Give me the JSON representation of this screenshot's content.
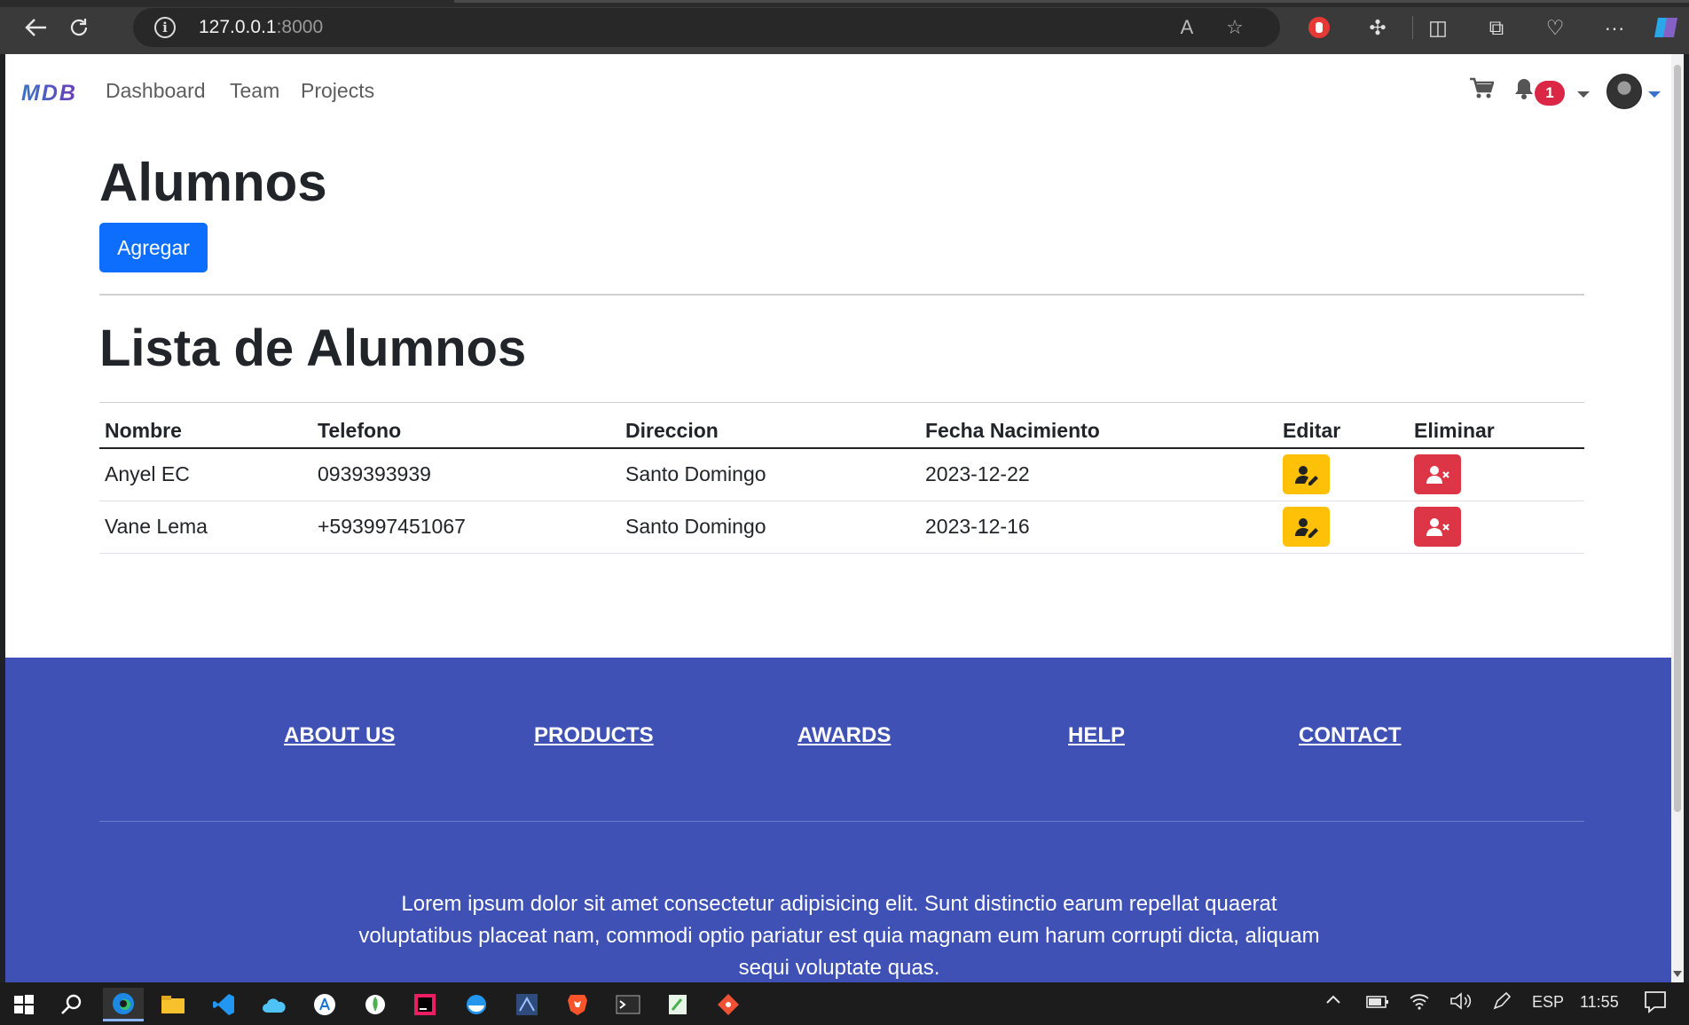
{
  "browser": {
    "url_host": "127.0.0.1",
    "url_port": ":8000"
  },
  "navbar": {
    "brand": "MDB",
    "links": [
      "Dashboard",
      "Team",
      "Projects"
    ],
    "notification_count": "1"
  },
  "main": {
    "title": "Alumnos",
    "add_label": "Agregar",
    "list_title": "Lista de Alumnos",
    "columns": [
      "Nombre",
      "Telefono",
      "Direccion",
      "Fecha Nacimiento",
      "Editar",
      "Eliminar"
    ],
    "rows": [
      {
        "nombre": "Anyel EC",
        "telefono": "0939393939",
        "direccion": "Santo Domingo",
        "fecha": "2023-12-22"
      },
      {
        "nombre": "Vane Lema",
        "telefono": "+593997451067",
        "direccion": "Santo Domingo",
        "fecha": "2023-12-16"
      }
    ]
  },
  "footer": {
    "links": [
      "ABOUT US",
      "PRODUCTS",
      "AWARDS",
      "HELP",
      "CONTACT"
    ],
    "text": "Lorem ipsum dolor sit amet consectetur adipisicing elit. Sunt distinctio earum repellat quaerat voluptatibus placeat nam, commodi optio pariatur est quia magnam eum harum corrupti dicta, aliquam sequi voluptate quas."
  },
  "taskbar": {
    "language": "ESP",
    "time": "11:55"
  },
  "colors": {
    "primary": "#0d6efd",
    "warning": "#ffc107",
    "danger": "#dc3545",
    "footer": "#3f51b5"
  }
}
